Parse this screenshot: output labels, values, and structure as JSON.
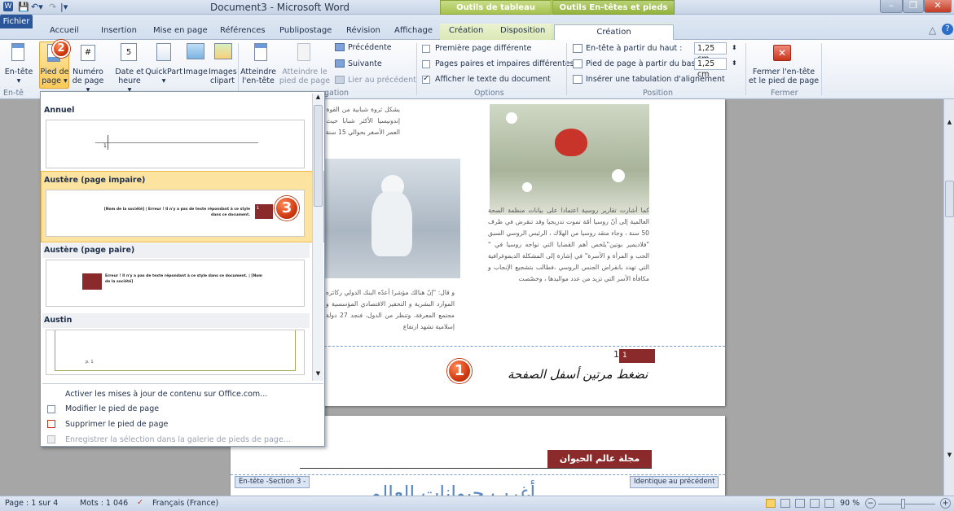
{
  "window": {
    "title": "Document3 - Microsoft Word",
    "context_groups": [
      "Outils de tableau",
      "Outils En-têtes et pieds de page"
    ]
  },
  "tabs": {
    "fichier": "Fichier",
    "items": [
      "Accueil",
      "Insertion",
      "Mise en page",
      "Références",
      "Publipostage",
      "Révision",
      "Affichage",
      "Création",
      "Disposition"
    ],
    "active": "Création"
  },
  "ribbon": {
    "entete": "En-tête",
    "pied": "Pied de page",
    "numero": "Numéro de page",
    "date": "Date et heure",
    "quickpart": "QuickPart",
    "image": "Image",
    "images_clipart": "Images clipart",
    "atteindre_entete": "Atteindre l'en-tête",
    "atteindre_pied": "Atteindre le pied de page",
    "precedente": "Précédente",
    "suivante": "Suivante",
    "lier": "Lier au précédent",
    "nav_group": "gation",
    "insert_group": "En-tê",
    "opt1": "Première page différente",
    "opt2": "Pages paires et impaires différentes",
    "opt3": "Afficher le texte du document",
    "options_group": "Options",
    "pos1": "En-tête à partir du haut :",
    "pos1_val": "1,25 cm",
    "pos2": "Pied de page à partir du bas :",
    "pos2_val": "1,25 cm",
    "pos3": "Insérer une tabulation d'alignement",
    "position_group": "Position",
    "fermer": "Fermer l'en-tête et le pied de page",
    "fermer_group": "Fermer"
  },
  "dropdown": {
    "sec_annuel": "Annuel",
    "annuel_num": "1",
    "sec_austere_impaire": "Austère (page impaire)",
    "austere_impaire_text": "[Nom de la société] | Erreur ! Il n'y a pas de texte répondant à ce style dans ce document.",
    "austere_impaire_num": "1",
    "sec_austere_paire": "Austère (page paire)",
    "austere_paire_text": "Erreur ! Il n'y a pas de texte répondant à ce style dans ce document. | [Nom de la société]",
    "austere_paire_num": "1",
    "sec_austin": "Austin",
    "austin_text": "p. 1",
    "menu_activer": "Activer les mises à jour de contenu sur Office.com...",
    "menu_modifier": "Modifier le pied de page",
    "menu_supprimer": "Supprimer le pied de page",
    "menu_enregistrer": "Enregistrer la sélection dans la galerie de pieds de page..."
  },
  "document": {
    "para1": "يشكل ثروة شبابية من القوة العاملة ، إندونيسيا الأكثر شبابا حيث متوسط العمر الأصغر بحوالي 15 سنة.",
    "para2": "كما أشارت تقارير روسية اعتمادا على بيانات منظمة الصحة العالمية إلى أنّ روسيا أمّة تموت تدريجيا وقد تنقرض في ظرف 50 سنة ، وجاء متقد روسيا من الهلاك ، الرئيس الروسي السبق \"فلاديمير بوتين\"يلخص أهم القضايا التي تواجه روسيا في \" الحب و المرأة و الأسرة\" في إشارة إلى المشكلة الديموغرافية التي تهدد بانقراض الجنس الروسي ،فطالب بتشجيع الإنجاب و مكافأة الأسر التي تزيد من عدد مواليدها ، وخصّصت",
    "para3": "و قال: \"إنّ هنالك مؤشرا أعدّه البنك الدولي ركائزه الموارد البشرية و التحفيز الاقتصادي المؤسسية و مجتمع المعرفة، وتنظر من الدول، فنجد 27 دولة إسلامية تشهد ارتفاع",
    "footer_page_num": "1",
    "footer_page_num_box": "1",
    "annotation_1": "نضغط مرتين أسفل الصفحة",
    "header_title": "مجلة عالم الحيوان",
    "header_label": "En-tête -Section 3 -",
    "identique": "Identique au précédent",
    "page2_big": "أغرب حيوانات العالم"
  },
  "badges": {
    "b1": "1",
    "b2": "2",
    "b3": "3"
  },
  "statusbar": {
    "page": "Page : 1 sur 4",
    "mots": "Mots : 1 046",
    "lang": "Français (France)",
    "zoom": "90 %"
  },
  "colors": {
    "accent": "#2b579a",
    "footer_red": "#8b2a2a",
    "badge": "#d33a10"
  }
}
